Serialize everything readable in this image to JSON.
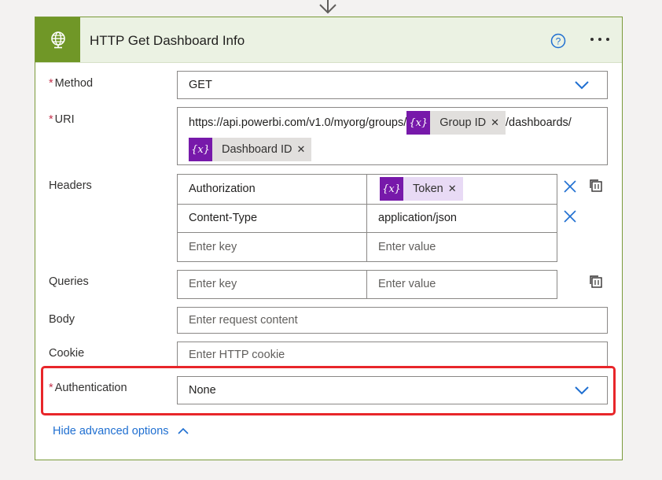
{
  "action": {
    "title": "HTTP Get Dashboard Info",
    "icon": "globe-icon",
    "accent_color": "#709727"
  },
  "fields": {
    "method": {
      "label": "Method",
      "required": true,
      "value": "GET"
    },
    "uri": {
      "label": "URI",
      "required": true,
      "text_prefix": "https://api.powerbi.com/v1.0/myorg/groups/",
      "token1": {
        "label": "Group ID",
        "fx": "{x}"
      },
      "text_middle": "/dashboards/",
      "token2": {
        "label": "Dashboard ID",
        "fx": "{x}"
      }
    },
    "headers": {
      "label": "Headers",
      "rows": [
        {
          "key": "Authorization",
          "value_token": "Token",
          "fx": "{x}"
        },
        {
          "key": "Content-Type",
          "value": "application/json"
        }
      ],
      "key_placeholder": "Enter key",
      "value_placeholder": "Enter value"
    },
    "queries": {
      "label": "Queries",
      "key_placeholder": "Enter key",
      "value_placeholder": "Enter value"
    },
    "body": {
      "label": "Body",
      "placeholder": "Enter request content"
    },
    "cookie": {
      "label": "Cookie",
      "placeholder": "Enter HTTP cookie"
    },
    "authentication": {
      "label": "Authentication",
      "required": true,
      "value": "None"
    }
  },
  "footer": {
    "hide_advanced": "Hide advanced options"
  },
  "colors": {
    "token_purple": "#7719aa",
    "link_blue": "#1f6fd1",
    "highlight_red": "#e8262a",
    "required_star": "#c4314b"
  }
}
